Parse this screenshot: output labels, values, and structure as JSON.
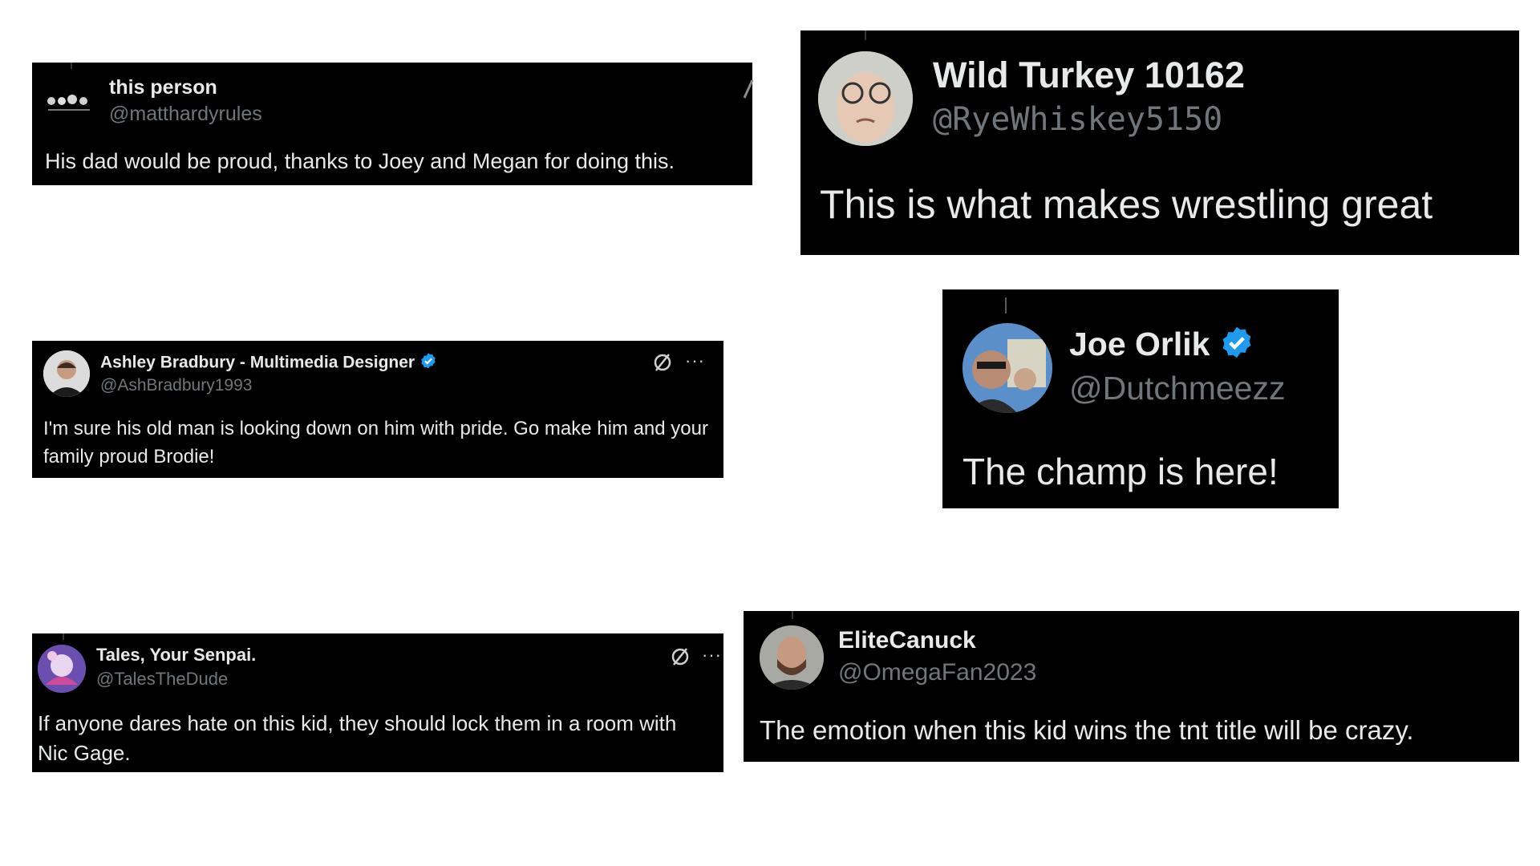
{
  "tweets": [
    {
      "id": "t1",
      "name": "this person",
      "handle": "@matthardyrules",
      "text": "His dad would be proud, thanks to Joey and Megan for doing this.",
      "verified": false
    },
    {
      "id": "t2",
      "name": "Wild Turkey 10162",
      "handle": "@RyeWhiskey5150",
      "text": "This is what makes wrestling great",
      "verified": false
    },
    {
      "id": "t3",
      "name": "Ashley Bradbury - Multimedia Designer",
      "handle": "@AshBradbury1993",
      "text": "I'm sure his old man is looking down on him with pride.  Go make him and your family proud Brodie!",
      "verified": true
    },
    {
      "id": "t4",
      "name": "Joe Orlik",
      "handle": "@Dutchmeezz",
      "text": "The champ is here!",
      "verified": true
    },
    {
      "id": "t5",
      "name": "Tales, Your Senpai.",
      "handle": "@TalesTheDude",
      "text": "If anyone dares hate on this kid, they should lock them in a room with Nic Gage.",
      "verified": false
    },
    {
      "id": "t6",
      "name": "EliteCanuck",
      "handle": "@OmegaFan2023",
      "text": "The emotion when this kid wins the tnt title will be crazy.",
      "verified": false
    }
  ],
  "colors": {
    "card_bg": "#000000",
    "text": "#e7e9ea",
    "muted": "#71767b",
    "verified": "#1d9bf0"
  },
  "icons": {
    "grok": "grok-icon",
    "more": "more-icon",
    "verified": "verified-badge-icon"
  },
  "more_glyph": "···"
}
